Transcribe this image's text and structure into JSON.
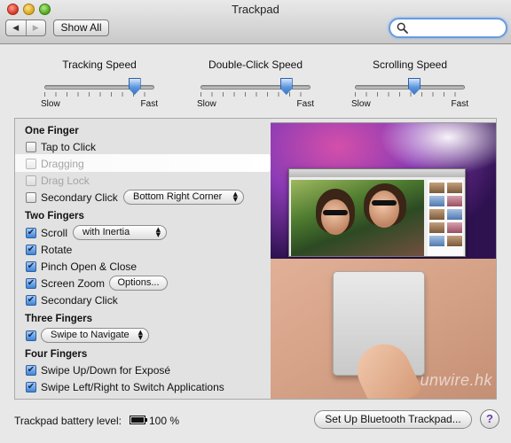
{
  "window": {
    "title": "Trackpad"
  },
  "toolbar": {
    "back_label": "◀",
    "forward_label": "▶",
    "show_all_label": "Show All",
    "search_value": "",
    "search_placeholder": ""
  },
  "sliders": [
    {
      "title": "Tracking Speed",
      "min_label": "Slow",
      "max_label": "Fast",
      "value_fraction": 0.82
    },
    {
      "title": "Double-Click Speed",
      "min_label": "Slow",
      "max_label": "Fast",
      "value_fraction": 0.78
    },
    {
      "title": "Scrolling Speed",
      "min_label": "Slow",
      "max_label": "Fast",
      "value_fraction": 0.54
    }
  ],
  "one_finger": {
    "title": "One Finger",
    "tap_to_click": {
      "label": "Tap to Click",
      "checked": false
    },
    "dragging": {
      "label": "Dragging",
      "checked": false,
      "enabled": false
    },
    "drag_lock": {
      "label": "Drag Lock",
      "checked": false,
      "enabled": false
    },
    "secondary_click": {
      "label": "Secondary Click",
      "checked": false,
      "option": "Bottom Right Corner"
    }
  },
  "two_fingers": {
    "title": "Two Fingers",
    "scroll": {
      "label": "Scroll",
      "checked": true,
      "option": "with Inertia"
    },
    "rotate": {
      "label": "Rotate",
      "checked": true
    },
    "pinch": {
      "label": "Pinch Open & Close",
      "checked": true
    },
    "screen_zoom": {
      "label": "Screen Zoom",
      "checked": true,
      "options_label": "Options..."
    },
    "secondary_click": {
      "label": "Secondary Click",
      "checked": true
    }
  },
  "three_fingers": {
    "title": "Three Fingers",
    "swipe": {
      "checked": true,
      "option": "Swipe to Navigate"
    }
  },
  "four_fingers": {
    "title": "Four Fingers",
    "swipe_up_down": {
      "label": "Swipe Up/Down for Exposé",
      "checked": true
    },
    "swipe_left_right": {
      "label": "Swipe Left/Right to Switch Applications",
      "checked": true
    }
  },
  "preview": {
    "watermark": "unwire.hk"
  },
  "footer": {
    "battery_label": "Trackpad battery level:",
    "battery_value": "100 %",
    "battery_percent": 100,
    "bluetooth_button": "Set Up Bluetooth Trackpad...",
    "help_label": "?"
  },
  "colors": {
    "accent": "#3f83d8",
    "window_bg": "#e8e8e8",
    "search_focus_ring": "#6b9be0"
  }
}
